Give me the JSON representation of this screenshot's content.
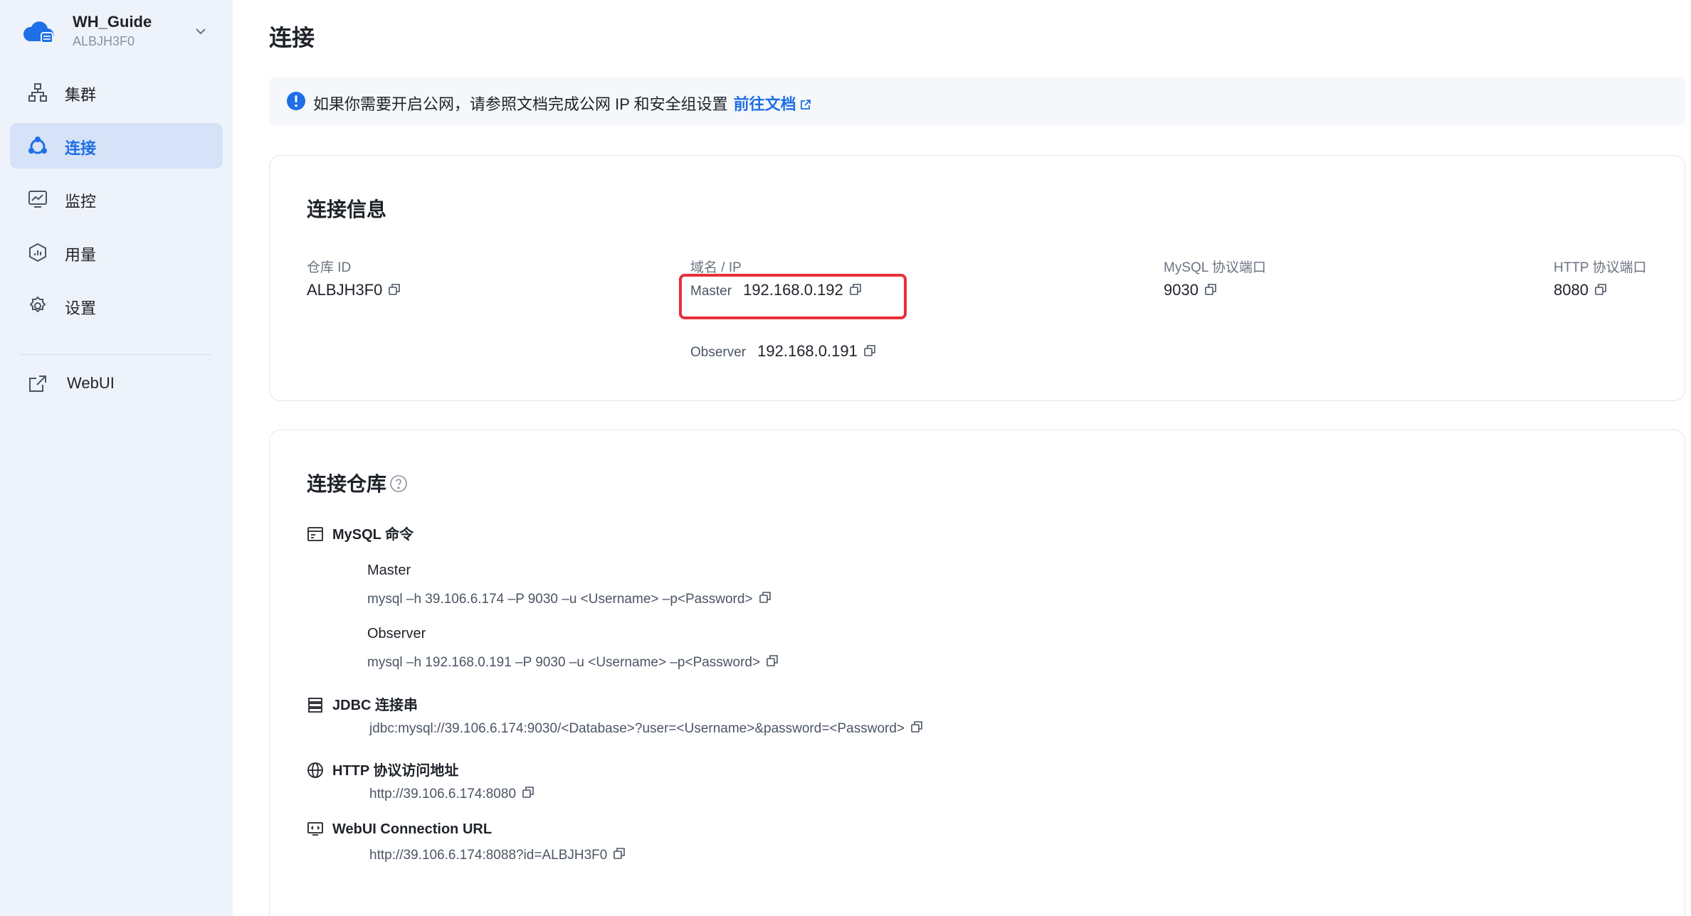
{
  "workspace": {
    "name": "WH_Guide",
    "id": "ALBJH3F0"
  },
  "sidebar": {
    "items": [
      {
        "label": "集群",
        "icon": "cluster-icon"
      },
      {
        "label": "连接",
        "icon": "connect-icon",
        "active": true
      },
      {
        "label": "监控",
        "icon": "monitor-icon"
      },
      {
        "label": "用量",
        "icon": "usage-icon"
      },
      {
        "label": "设置",
        "icon": "settings-icon"
      }
    ],
    "external": {
      "label": "WebUI",
      "icon": "external-link-icon"
    }
  },
  "page": {
    "title": "连接"
  },
  "banner": {
    "text": "如果你需要开启公网，请参照文档完成公网 IP 和安全组设置",
    "link": "前往文档"
  },
  "connection_info": {
    "title": "连接信息",
    "warehouse_id_label": "仓库 ID",
    "warehouse_id": "ALBJH3F0",
    "domain_label": "域名 / IP",
    "master_label": "Master",
    "master_ip": "192.168.0.192",
    "observer_label": "Observer",
    "observer_ip": "192.168.0.191",
    "mysql_port_label": "MySQL 协议端口",
    "mysql_port": "9030",
    "http_port_label": "HTTP 协议端口",
    "http_port": "8080"
  },
  "connect_warehouse": {
    "title": "连接仓库",
    "mysql": {
      "label": "MySQL 命令",
      "master_label": "Master",
      "master_cmd": "mysql –h 39.106.6.174 –P 9030 –u <Username> –p<Password>",
      "observer_label": "Observer",
      "observer_cmd": "mysql –h 192.168.0.191 –P 9030 –u <Username> –p<Password>"
    },
    "jdbc": {
      "label": "JDBC 连接串",
      "value": "jdbc:mysql://39.106.6.174:9030/<Database>?user=<Username>&password=<Password>"
    },
    "http": {
      "label": "HTTP 协议访问地址",
      "value": "http://39.106.6.174:8080"
    },
    "webui": {
      "label": "WebUI Connection URL",
      "value": "http://39.106.6.174:8088?id=ALBJH3F0"
    }
  },
  "colors": {
    "accent": "#1f6fe6",
    "sidebar_bg": "#eef2fa",
    "active_bg": "#d6e2f7",
    "highlight": "#e8303a"
  }
}
